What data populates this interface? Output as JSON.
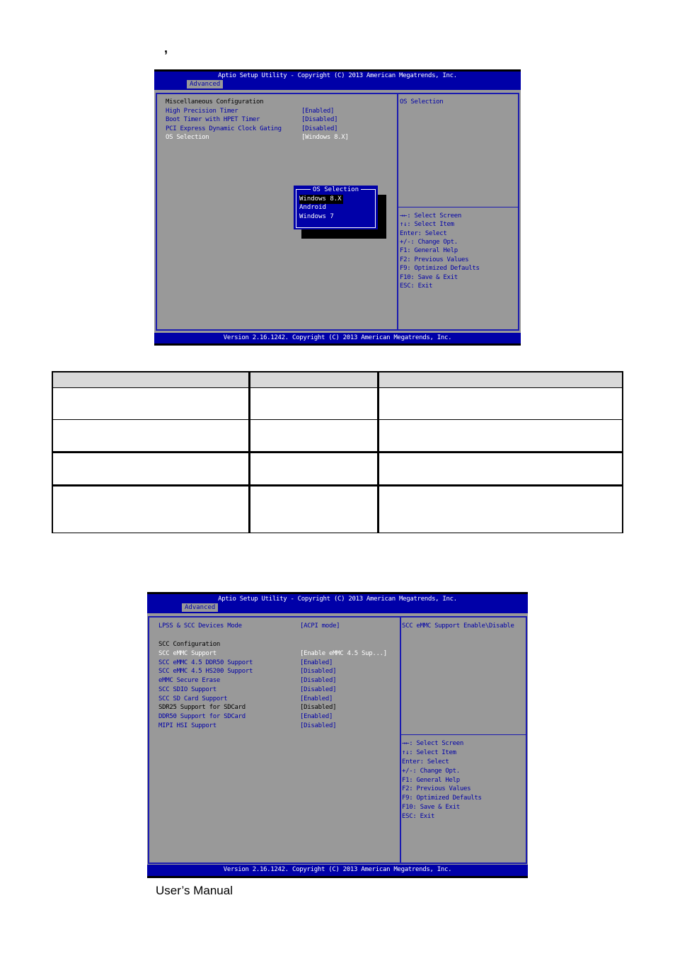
{
  "page_marks": {
    "comma": ","
  },
  "bios1": {
    "title": "Aptio Setup Utility - Copyright (C) 2013 American Megatrends, Inc.",
    "tab": "Advanced",
    "section_heading": "Miscellaneous Configuration",
    "items": [
      {
        "label": "High Precision Timer",
        "value": "[Enabled]"
      },
      {
        "label": "Boot Timer with HPET Timer",
        "value": "[Disabled]"
      },
      {
        "label": "PCI Express Dynamic Clock Gating",
        "value": "[Disabled]"
      },
      {
        "label": "OS Selection",
        "value": "[Windows 8.X]"
      }
    ],
    "help_text": "OS Selection",
    "popup": {
      "title": "OS Selection",
      "options": [
        "Windows 8.X",
        "Android",
        "Windows 7"
      ],
      "selected": "Windows 8.X"
    },
    "keys": [
      "→←: Select Screen",
      "↑↓: Select Item",
      "Enter: Select",
      "+/-: Change Opt.",
      "F1: General Help",
      "F2: Previous Values",
      "F9: Optimized Defaults",
      "F10: Save & Exit",
      "ESC: Exit"
    ],
    "footer": "Version 2.16.1242. Copyright (C) 2013 American Megatrends, Inc."
  },
  "table": {
    "header": [
      "",
      "",
      ""
    ],
    "rows": [
      [
        "",
        "",
        ""
      ],
      [
        "",
        "",
        ""
      ],
      [
        "",
        "",
        ""
      ],
      [
        "",
        "",
        ""
      ]
    ]
  },
  "bios2": {
    "title": "Aptio Setup Utility - Copyright (C) 2013 American Megatrends, Inc.",
    "tab": "Advanced",
    "top_item": {
      "label": "LPSS & SCC Devices Mode",
      "value": "[ACPI mode]"
    },
    "section_heading": "SCC Configuration",
    "items": [
      {
        "label": "SCC eMMC Support",
        "value": "[Enable eMMC 4.5 Sup...]",
        "state": "selected"
      },
      {
        "label": "SCC eMMC 4.5 DDR50 Support",
        "value": "[Enabled]",
        "state": "normal"
      },
      {
        "label": "SCC eMMC 4.5 HS200 Support",
        "value": "[Disabled]",
        "state": "normal"
      },
      {
        "label": "eMMC Secure Erase",
        "value": "[Disabled]",
        "state": "normal"
      },
      {
        "label": "SCC SDIO Support",
        "value": "[Disabled]",
        "state": "normal"
      },
      {
        "label": "SCC SD Card Support",
        "value": "[Enabled]",
        "state": "normal"
      },
      {
        "label": "SDR25 Support for SDCard",
        "value": "[Disabled]",
        "state": "readonly"
      },
      {
        "label": "DDR50 Support for SDCard",
        "value": "[Enabled]",
        "state": "normal"
      },
      {
        "label": "MIPI HSI Support",
        "value": "[Disabled]",
        "state": "normal"
      }
    ],
    "help_text": "SCC eMMC Support Enable\\Disable",
    "keys": [
      "→←: Select Screen",
      "↑↓: Select Item",
      "Enter: Select",
      "+/-: Change Opt.",
      "F1: General Help",
      "F2: Previous Values",
      "F9: Optimized Defaults",
      "F10: Save & Exit",
      "ESC: Exit"
    ],
    "footer": "Version 2.16.1242. Copyright (C) 2013 American Megatrends, Inc."
  },
  "footer": {
    "text": "User’s Manual"
  },
  "colors": {
    "bios_blue": "#0000a8",
    "bios_gray": "#999999",
    "table_header": "#d9d9d9"
  }
}
